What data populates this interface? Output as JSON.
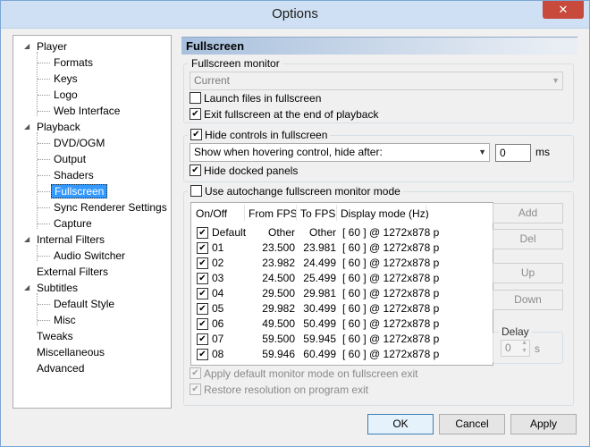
{
  "window": {
    "title": "Options",
    "close_label": "✕"
  },
  "tree": {
    "items": [
      {
        "label": "Player",
        "expanded": true
      },
      {
        "label": "Formats"
      },
      {
        "label": "Keys"
      },
      {
        "label": "Logo"
      },
      {
        "label": "Web Interface"
      },
      {
        "label": "Playback",
        "expanded": true
      },
      {
        "label": "DVD/OGM"
      },
      {
        "label": "Output"
      },
      {
        "label": "Shaders"
      },
      {
        "label": "Fullscreen",
        "selected": true
      },
      {
        "label": "Sync Renderer Settings"
      },
      {
        "label": "Capture"
      },
      {
        "label": "Internal Filters",
        "expanded": true
      },
      {
        "label": "Audio Switcher"
      },
      {
        "label": "External Filters"
      },
      {
        "label": "Subtitles",
        "expanded": true
      },
      {
        "label": "Default Style"
      },
      {
        "label": "Misc"
      },
      {
        "label": "Tweaks"
      },
      {
        "label": "Miscellaneous"
      },
      {
        "label": "Advanced"
      }
    ]
  },
  "panel": {
    "header": "Fullscreen",
    "monitor_group": {
      "title": "Fullscreen monitor",
      "monitor_value": "Current",
      "launch_label": "Launch files in fullscreen",
      "launch_checked": false,
      "exit_label": "Exit fullscreen at the end of playback",
      "exit_checked": true
    },
    "hide_group": {
      "title": "Hide controls in fullscreen",
      "title_checked": true,
      "mode_value": "Show when hovering control, hide after:",
      "delay_value": "0",
      "delay_unit": "ms",
      "docked_label": "Hide docked panels",
      "docked_checked": true
    },
    "autochange_group": {
      "title": "Use autochange fullscreen monitor mode",
      "title_checked": false,
      "columns": [
        "On/Off",
        "From FPS",
        "To FPS",
        "Display mode (Hz)"
      ],
      "rows": [
        {
          "name": "Default",
          "from": "Other",
          "to": "Other",
          "mode": "[ 60 ] @ 1272x878 p",
          "checked": true
        },
        {
          "name": "01",
          "from": "23.500",
          "to": "23.981",
          "mode": "[ 60 ] @ 1272x878 p",
          "checked": true
        },
        {
          "name": "02",
          "from": "23.982",
          "to": "24.499",
          "mode": "[ 60 ] @ 1272x878 p",
          "checked": true
        },
        {
          "name": "03",
          "from": "24.500",
          "to": "25.499",
          "mode": "[ 60 ] @ 1272x878 p",
          "checked": true
        },
        {
          "name": "04",
          "from": "29.500",
          "to": "29.981",
          "mode": "[ 60 ] @ 1272x878 p",
          "checked": true
        },
        {
          "name": "05",
          "from": "29.982",
          "to": "30.499",
          "mode": "[ 60 ] @ 1272x878 p",
          "checked": true
        },
        {
          "name": "06",
          "from": "49.500",
          "to": "50.499",
          "mode": "[ 60 ] @ 1272x878 p",
          "checked": true
        },
        {
          "name": "07",
          "from": "59.500",
          "to": "59.945",
          "mode": "[ 60 ] @ 1272x878 p",
          "checked": true
        },
        {
          "name": "08",
          "from": "59.946",
          "to": "60.499",
          "mode": "[ 60 ] @ 1272x878 p",
          "checked": true
        }
      ],
      "add_label": "Add",
      "del_label": "Del",
      "up_label": "Up",
      "down_label": "Down",
      "delay_title": "Delay",
      "delay_value": "0",
      "delay_unit": "s",
      "apply_default_label": "Apply default monitor mode on fullscreen exit",
      "apply_default_checked": true,
      "restore_label": "Restore resolution on program exit",
      "restore_checked": true
    }
  },
  "footer": {
    "ok_label": "OK",
    "cancel_label": "Cancel",
    "apply_label": "Apply"
  }
}
